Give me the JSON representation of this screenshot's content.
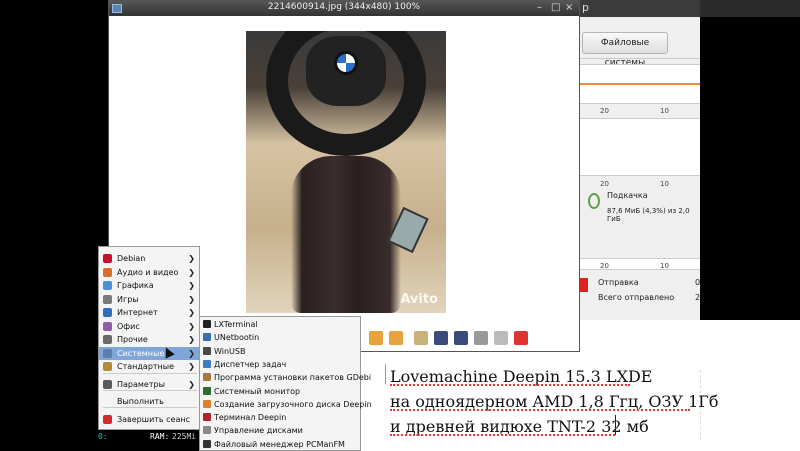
{
  "viewer": {
    "title": "2214600914.jpg (344x480) 100%",
    "minimize": "–",
    "maximize": "□",
    "close": "×",
    "watermark": "Avito"
  },
  "sysmon": {
    "title_fragment": "p",
    "fs_button": "Файловые системы",
    "tick_a": "20",
    "tick_b": "10",
    "swap_title": "Подкачка",
    "swap_value": "87,6 МиБ (4,3%) из 2,0 ГиБ",
    "sent_label": "Отправка",
    "sent_value": "0",
    "total_sent_label": "Всего отправлено",
    "total_sent_value": "2"
  },
  "document": {
    "line1": "Lovemachine Deepin 15.3 LXDE",
    "line2": "на одноядерном AMD 1,8 Ггц,  ОЗУ 1Гб",
    "line3": "и древней видюхе TNT-2 32 мб"
  },
  "terminal": {
    "prefix": "0:",
    "ram_label": "RAM:",
    "ram_value": "225Mi"
  },
  "menu": {
    "items": [
      {
        "label": "Debian",
        "icon": "debian-icon",
        "color": "#c8102e"
      },
      {
        "label": "Аудио и видео",
        "icon": "multimedia-icon",
        "color": "#d86d2c"
      },
      {
        "label": "Графика",
        "icon": "graphics-icon",
        "color": "#4a90d9"
      },
      {
        "label": "Игры",
        "icon": "games-icon",
        "color": "#7a7a7a"
      },
      {
        "label": "Интернет",
        "icon": "internet-icon",
        "color": "#2f6fbf"
      },
      {
        "label": "Офис",
        "icon": "office-icon",
        "color": "#8e5fa8"
      },
      {
        "label": "Прочие",
        "icon": "other-icon",
        "color": "#6a6a6a"
      },
      {
        "label": "Системные",
        "icon": "system-icon",
        "color": "#5b7fa8"
      },
      {
        "label": "Стандартные",
        "icon": "accessories-icon",
        "color": "#b08a3c"
      },
      {
        "label": "Параметры",
        "icon": "preferences-icon",
        "color": "#5a5a5a"
      },
      {
        "label": "Выполнить",
        "icon": "run-icon",
        "color": "#f4f4f4"
      },
      {
        "label": "Завершить сеанс",
        "icon": "logout-icon",
        "color": "#d22b2b"
      }
    ]
  },
  "submenu": {
    "items": [
      {
        "label": "LXTerminal",
        "icon": "terminal-icon",
        "color": "#222222"
      },
      {
        "label": "UNetbootin",
        "icon": "unetbootin-icon",
        "color": "#3a6cb3"
      },
      {
        "label": "WinUSB",
        "icon": "winusb-icon",
        "color": "#4a4a4a"
      },
      {
        "label": "Диспетчер задач",
        "icon": "task-manager-icon",
        "color": "#3f7bbd"
      },
      {
        "label": "Программа установки пакетов GDebi",
        "icon": "package-icon",
        "color": "#a77a3a"
      },
      {
        "label": "Системный монитор",
        "icon": "monitor-icon",
        "color": "#2d6e2d"
      },
      {
        "label": "Создание загрузочного диска Deepin",
        "icon": "boot-disk-icon",
        "color": "#d9822b"
      },
      {
        "label": "Терминал Deepin",
        "icon": "deepin-terminal-icon",
        "color": "#b42323"
      },
      {
        "label": "Управление дисками",
        "icon": "disks-icon",
        "color": "#888888"
      },
      {
        "label": "Файловый менеджер PCManFM",
        "icon": "file-manager-icon",
        "color": "#333333"
      }
    ]
  }
}
